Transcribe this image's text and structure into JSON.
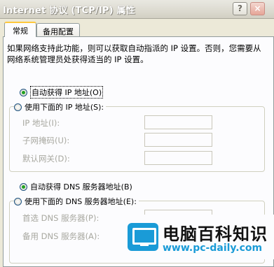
{
  "window": {
    "title": "Internet 协议 (TCP/IP) 属性",
    "help_glyph": "?",
    "close_glyph": "×"
  },
  "tabs": [
    {
      "label": "常规"
    },
    {
      "label": "备用配置"
    }
  ],
  "description": "如果网络支持此功能，则可以获取自动指派的 IP 设置。否则，您需要从网络系统管理员处获得适当的 IP 设置。",
  "ip": {
    "auto_label": "自动获得 IP 地址(O)",
    "manual_label": "使用下面的 IP 地址(S):",
    "fields": [
      {
        "label": "IP 地址(I):",
        "value": ""
      },
      {
        "label": "子网掩码(U):",
        "value": ""
      },
      {
        "label": "默认网关(D):",
        "value": ""
      }
    ]
  },
  "dns": {
    "auto_label": "自动获得 DNS 服务器地址(B)",
    "manual_label": "使用下面的 DNS 服务器地址(E):",
    "fields": [
      {
        "label": "首选 DNS 服务器(P):",
        "value": ""
      },
      {
        "label": "备用 DNS 服务器(A):",
        "value": ""
      }
    ]
  },
  "watermark": {
    "title": "电脑百科知识",
    "url": "www.pc-daily.com"
  },
  "colors": {
    "dialog_bg": "#ece9d8",
    "panel_bg": "#fcfcfe",
    "radio_selected": "#21a121",
    "disabled_text": "#a8a8a0",
    "brand_blue": "#1a9bd7"
  }
}
